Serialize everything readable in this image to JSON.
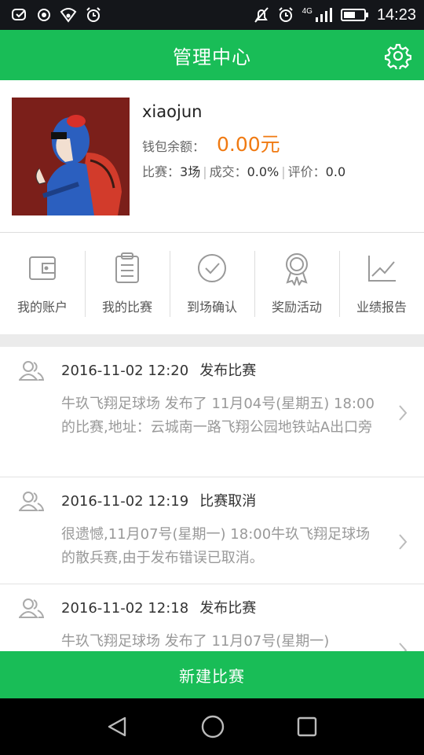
{
  "status_bar": {
    "time": "14:23",
    "network": "4G",
    "left_icons": [
      "message-icon",
      "location-icon",
      "wifi-icon",
      "alarm-icon"
    ],
    "right_icons": [
      "mute-icon",
      "alarm-icon",
      "signal-icon",
      "battery-icon"
    ]
  },
  "header": {
    "title": "管理中心",
    "settings_icon": "gear-icon"
  },
  "profile": {
    "username": "xiaojun",
    "balance_label": "钱包余额：",
    "balance_value": "0.00元",
    "matches_label": "比赛：",
    "matches_value": "3场",
    "deal_label": "成交：",
    "deal_value": "0.0%",
    "rating_label": "评价：",
    "rating_value": "0.0"
  },
  "menu": [
    {
      "label": "我的账户",
      "icon": "wallet-icon"
    },
    {
      "label": "我的比赛",
      "icon": "clipboard-icon"
    },
    {
      "label": "到场确认",
      "icon": "check-circle-icon"
    },
    {
      "label": "奖励活动",
      "icon": "award-icon"
    },
    {
      "label": "业绩报告",
      "icon": "chart-icon"
    }
  ],
  "feed": [
    {
      "datetime": "2016-11-02 12:20",
      "type": "发布比赛",
      "content": "牛玖飞翔足球场 发布了 11月04号(星期五) 18:00 的比赛,地址：云城南一路飞翔公园地铁站A出口旁"
    },
    {
      "datetime": "2016-11-02 12:19",
      "type": "比赛取消",
      "content": "很遗憾,11月07号(星期一) 18:00牛玖飞翔足球场的散兵赛,由于发布错误已取消。"
    },
    {
      "datetime": "2016-11-02 12:18",
      "type": "发布比赛",
      "content": "牛玖飞翔足球场 发布了 11月07号(星期一)"
    }
  ],
  "bottom_button": {
    "label": "新建比赛"
  },
  "colors": {
    "brand": "#19bd57",
    "accent": "#f07a12"
  }
}
